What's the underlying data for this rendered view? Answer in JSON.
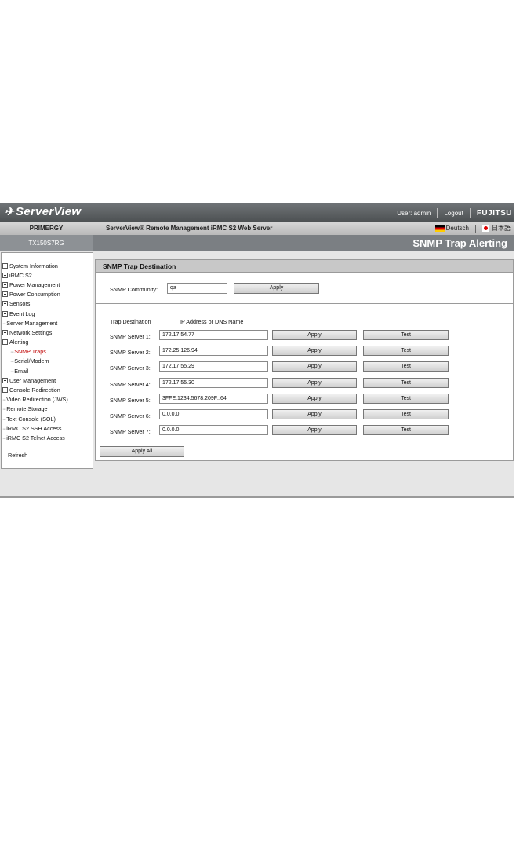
{
  "header": {
    "logo_text": "ServerView",
    "user_label": "User: admin",
    "logout_label": "Logout",
    "brand_label": "FUJITSU",
    "product": "PRIMERGY",
    "server_title": "ServerView® Remote Management iRMC S2 Web Server",
    "lang_de": "Deutsch",
    "lang_jp": "日本語",
    "model": "TX150S7RG",
    "page_title": "SNMP Trap Alerting"
  },
  "sidebar": {
    "items": [
      {
        "label": "System Information",
        "kind": "plus"
      },
      {
        "label": "iRMC S2",
        "kind": "plus"
      },
      {
        "label": "Power Management",
        "kind": "plus"
      },
      {
        "label": "Power Consumption",
        "kind": "plus"
      },
      {
        "label": "Sensors",
        "kind": "plus"
      },
      {
        "label": "Event Log",
        "kind": "plus"
      },
      {
        "label": "Server Management",
        "kind": "leaf"
      },
      {
        "label": "Network Settings",
        "kind": "plus"
      },
      {
        "label": "Alerting",
        "kind": "minus"
      },
      {
        "label": "SNMP Traps",
        "kind": "sub",
        "active": true
      },
      {
        "label": "Serial/Modem",
        "kind": "sub"
      },
      {
        "label": "Email",
        "kind": "sub"
      },
      {
        "label": "User Management",
        "kind": "plus"
      },
      {
        "label": "Console Redirection",
        "kind": "plus"
      },
      {
        "label": "Video Redirection (JWS)",
        "kind": "leaf"
      },
      {
        "label": "Remote Storage",
        "kind": "leaf"
      },
      {
        "label": "Text Console (SOL)",
        "kind": "leaf"
      },
      {
        "label": "iRMC S2 SSH Access",
        "kind": "leaf"
      },
      {
        "label": "iRMC S2 Telnet Access",
        "kind": "leaf"
      }
    ],
    "refresh_label": "Refresh"
  },
  "main": {
    "section_title": "SNMP Trap Destination",
    "community_label": "SNMP Community:",
    "community_value": "qa",
    "community_apply": "Apply",
    "col_trap_destination": "Trap Destination",
    "col_ip": "IP Address or DNS Name",
    "servers": [
      {
        "label": "SNMP Server 1:",
        "value": "172.17.54.77",
        "apply": "Apply",
        "test": "Test"
      },
      {
        "label": "SNMP Server 2:",
        "value": "172.25.126.94",
        "apply": "Apply",
        "test": "Test"
      },
      {
        "label": "SNMP Server 3:",
        "value": "172.17.55.29",
        "apply": "Apply",
        "test": "Test"
      },
      {
        "label": "SNMP Server 4:",
        "value": "172.17.55.30",
        "apply": "Apply",
        "test": "Test"
      },
      {
        "label": "SNMP Server 5:",
        "value": "3FFE:1234:5678:209F::64",
        "apply": "Apply",
        "test": "Test"
      },
      {
        "label": "SNMP Server 6:",
        "value": "0.0.0.0",
        "apply": "Apply",
        "test": "Test"
      },
      {
        "label": "SNMP Server 7:",
        "value": "0.0.0.0",
        "apply": "Apply",
        "test": "Test"
      }
    ],
    "apply_all": "Apply All"
  }
}
